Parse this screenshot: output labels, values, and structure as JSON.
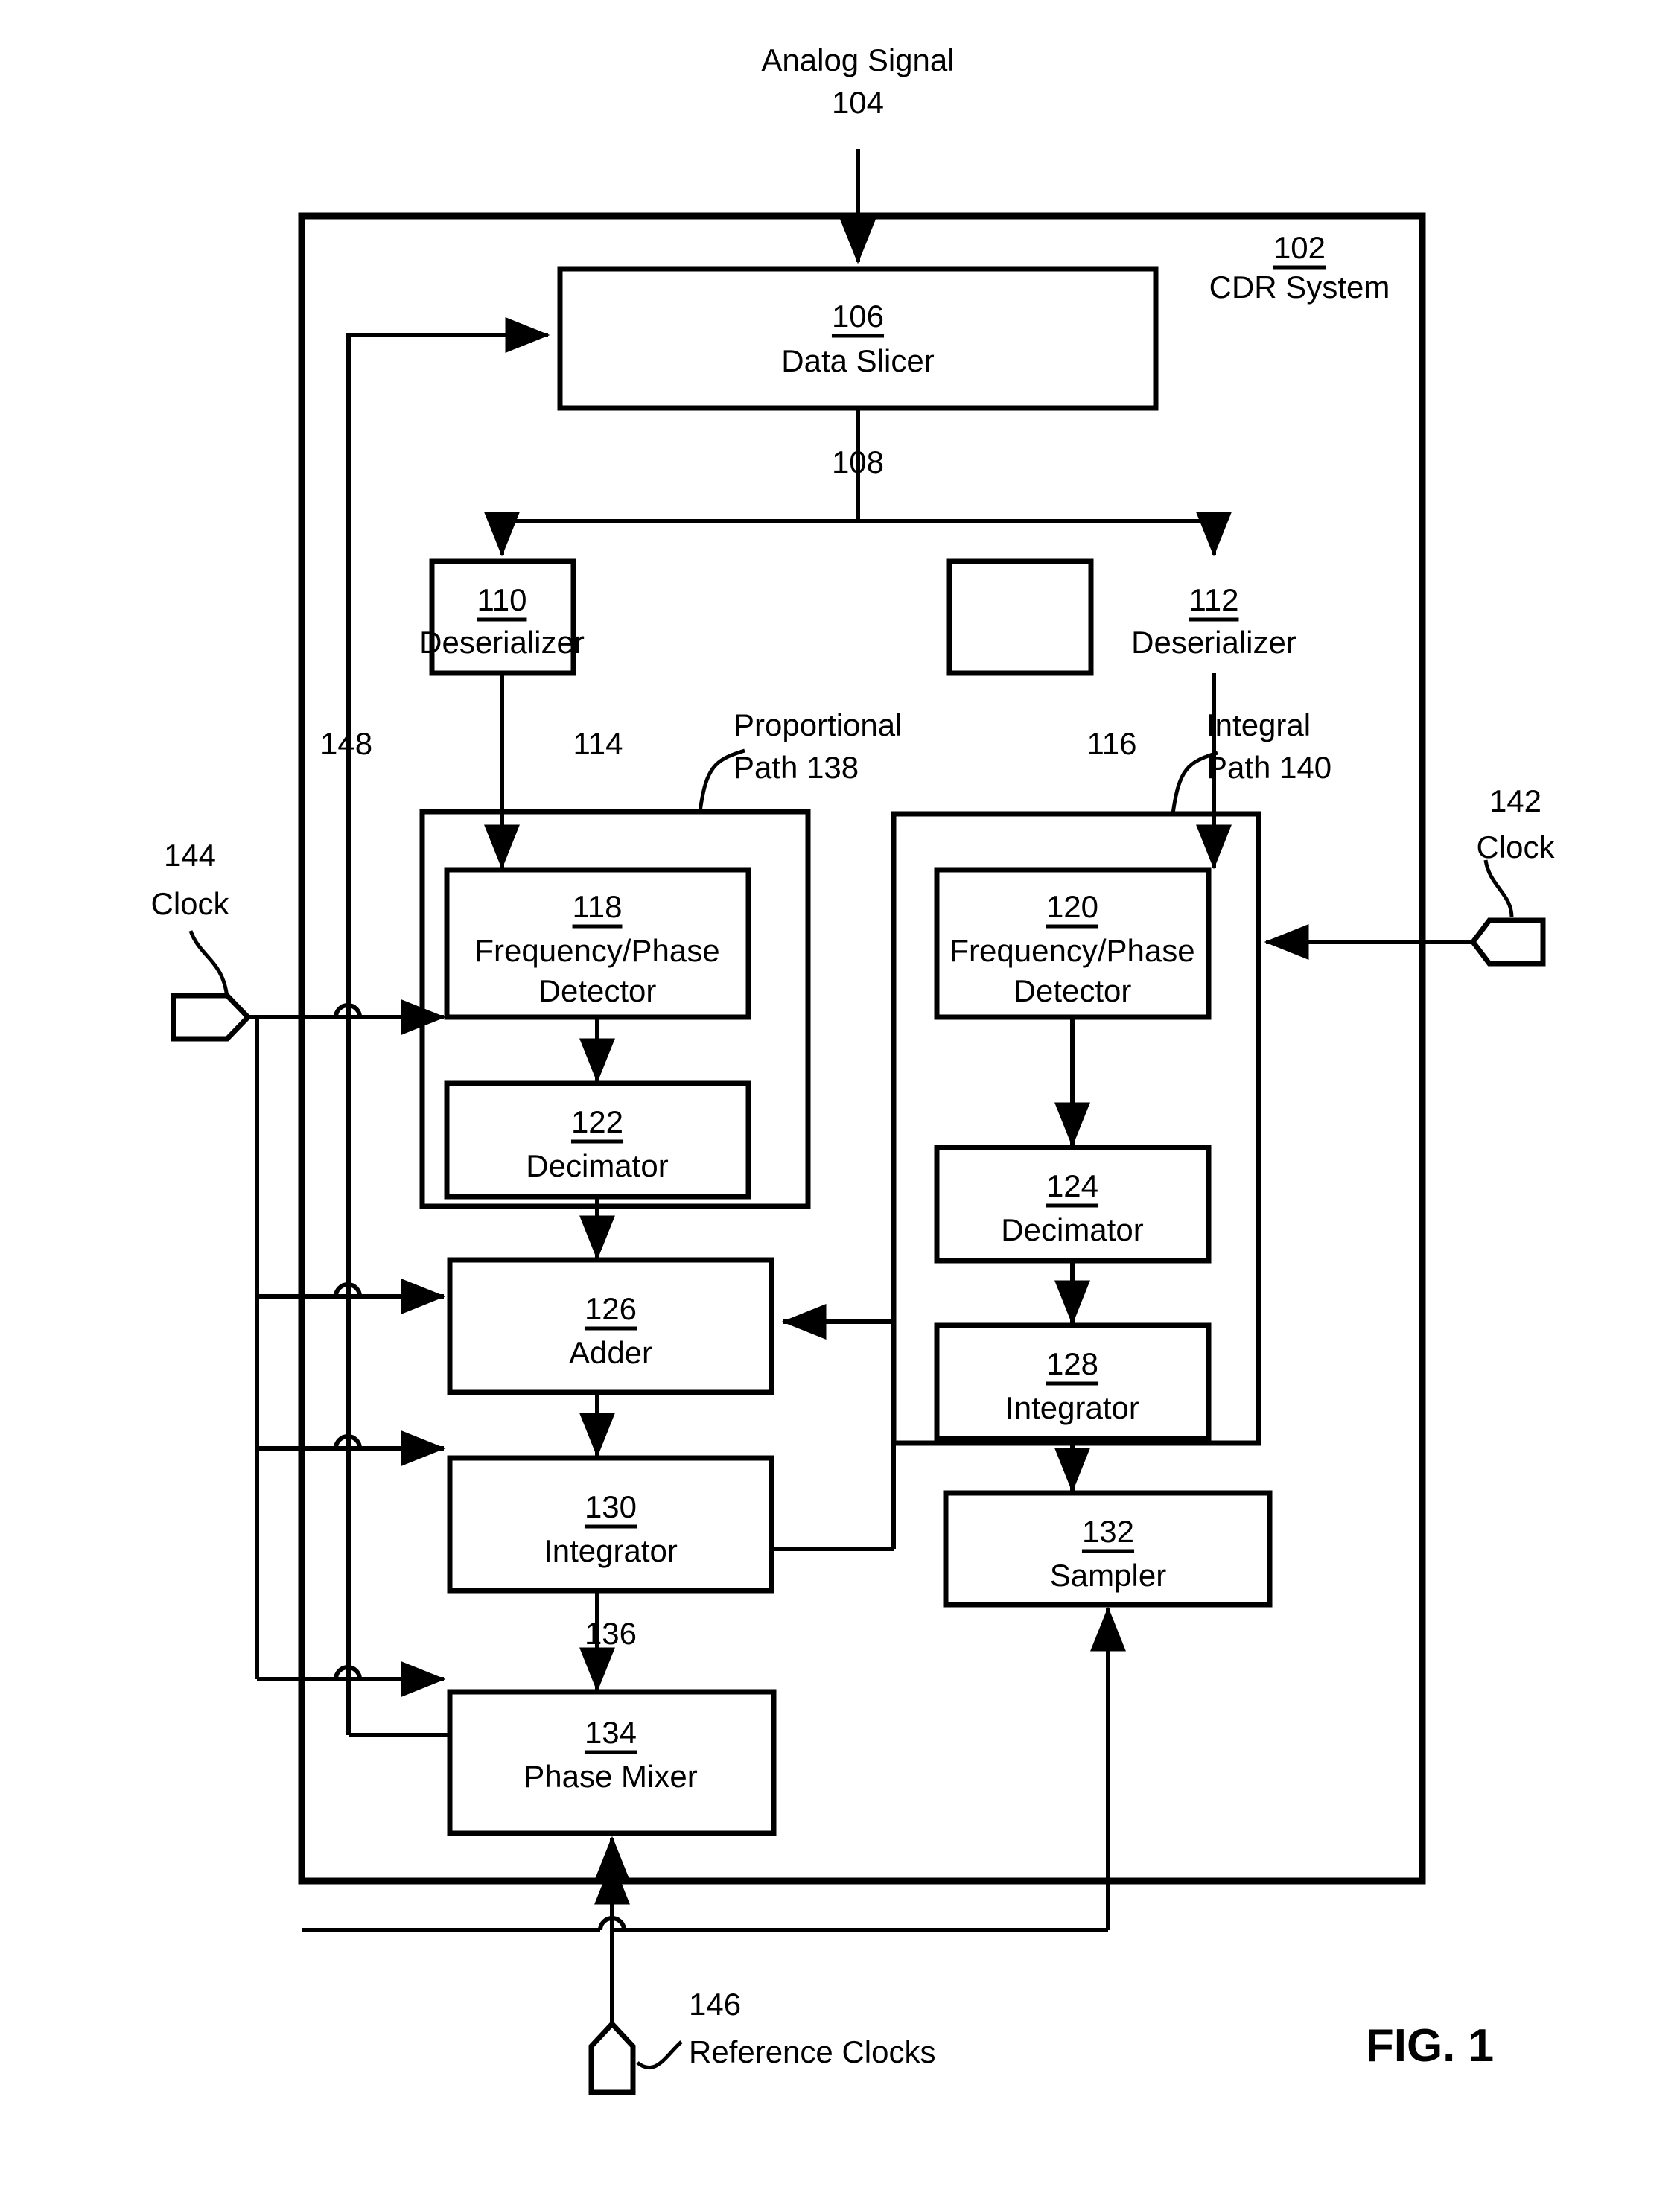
{
  "figure": {
    "label": "FIG. 1",
    "title": "CDR System block diagram"
  },
  "signals": {
    "analog_signal": {
      "name": "Analog Signal",
      "ref": "104"
    },
    "slicer_out": {
      "ref": "108"
    },
    "deser110_out": {
      "ref": "114"
    },
    "deser112_out": {
      "ref": "116"
    },
    "integrator_out": {
      "ref": "136"
    },
    "feedback": {
      "ref": "148"
    }
  },
  "system": {
    "ref": "102",
    "name": "CDR System"
  },
  "paths": {
    "proportional": {
      "name": "Proportional",
      "ref_line": "Path 138"
    },
    "integral": {
      "name": "Integral",
      "ref_line": "Path 140"
    }
  },
  "clocks": {
    "left": {
      "ref": "144",
      "name": "Clock"
    },
    "right": {
      "ref": "142",
      "name": "Clock"
    },
    "reference": {
      "ref": "146",
      "name": "Reference Clocks"
    }
  },
  "blocks": [
    {
      "ref": "106",
      "name": "Data Slicer"
    },
    {
      "ref": "110",
      "name": "Deserializer"
    },
    {
      "ref": "112",
      "name": "Deserializer"
    },
    {
      "ref": "118",
      "name_line1": "Frequency/Phase",
      "name_line2": "Detector"
    },
    {
      "ref": "120",
      "name_line1": "Frequency/Phase",
      "name_line2": "Detector"
    },
    {
      "ref": "122",
      "name": "Decimator"
    },
    {
      "ref": "124",
      "name": "Decimator"
    },
    {
      "ref": "126",
      "name": "Adder"
    },
    {
      "ref": "128",
      "name": "Integrator"
    },
    {
      "ref": "130",
      "name": "Integrator"
    },
    {
      "ref": "132",
      "name": "Sampler"
    },
    {
      "ref": "134",
      "name": "Phase Mixer"
    }
  ],
  "colors": {
    "ink": "#000000",
    "paper": "#ffffff"
  }
}
